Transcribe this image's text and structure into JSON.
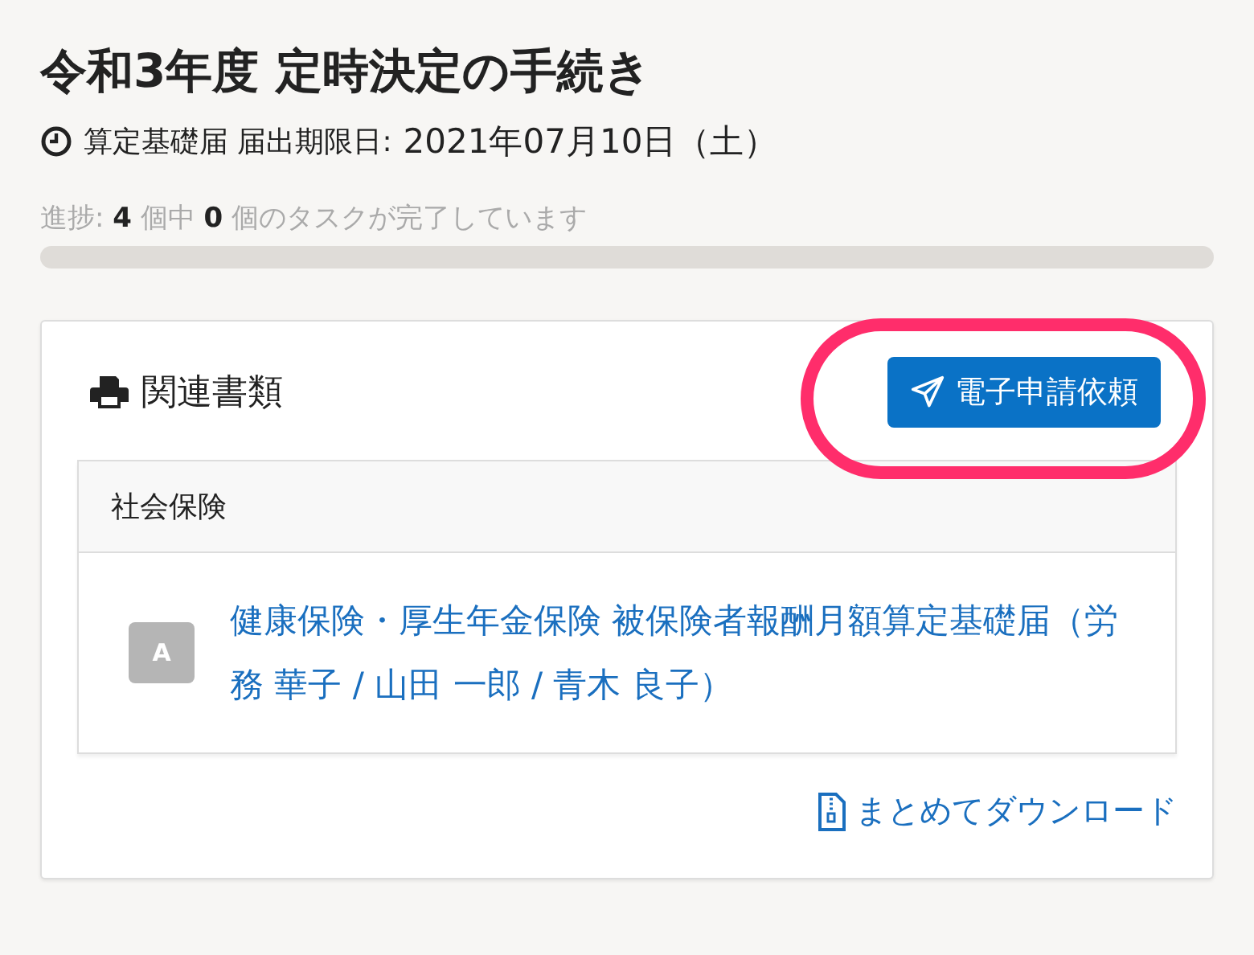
{
  "title": "令和3年度 定時決定の手続き",
  "subtitle": {
    "label": "算定基礎届 届出期限日:",
    "date": "2021年07月10日（土）"
  },
  "progress": {
    "text": "進捗: **4** 個中 **0** 個のタスクが完了しています",
    "level": 0
  },
  "card": {
    "title": "関連書類",
    "action_button": "電子申請依頼",
    "action_highlighted": true,
    "sections": [
      {
        "heading": "社会保険",
        "documents": [
          {
            "badge": "A",
            "link": "健康保険・厚生年金保険 被保険者報酬月額算定基礎届（労務 華子 / 山田 一郎 / 青木 良子）"
          }
        ]
      }
    ],
    "download_link": "まとめてダウンロード"
  }
}
